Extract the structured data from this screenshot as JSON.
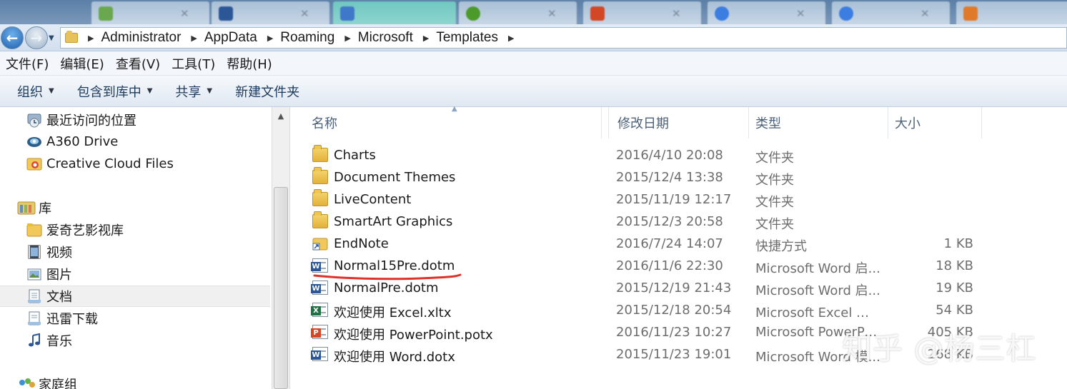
{
  "address": {
    "breadcrumbs": [
      "Administrator",
      "AppData",
      "Roaming",
      "Microsoft",
      "Templates"
    ]
  },
  "menubar": [
    "文件(F)",
    "编辑(E)",
    "查看(V)",
    "工具(T)",
    "帮助(H)"
  ],
  "commandbar": {
    "organize": "组织",
    "include_in_library": "包含到库中",
    "share": "共享",
    "new_folder": "新建文件夹"
  },
  "navpane": {
    "items": [
      {
        "label": "最近访问的位置",
        "icon": "recent-places-icon"
      },
      {
        "label": "A360 Drive",
        "icon": "a360-drive-icon"
      },
      {
        "label": "Creative Cloud Files",
        "icon": "creative-cloud-icon"
      },
      {
        "label": "库",
        "icon": "libraries-icon"
      },
      {
        "label": "爱奇艺影视库",
        "icon": "folder-icon"
      },
      {
        "label": "视频",
        "icon": "video-library-icon"
      },
      {
        "label": "图片",
        "icon": "pictures-library-icon"
      },
      {
        "label": "文档",
        "icon": "documents-library-icon",
        "selected": true
      },
      {
        "label": "迅雷下载",
        "icon": "download-library-icon"
      },
      {
        "label": "音乐",
        "icon": "music-library-icon"
      },
      {
        "label": "家庭组",
        "icon": "homegroup-icon"
      }
    ]
  },
  "columns": {
    "name": "名称",
    "date_modified": "修改日期",
    "type": "类型",
    "size": "大小"
  },
  "files": [
    {
      "name": "Charts",
      "date": "2016/4/10 20:08",
      "type": "文件夹",
      "size": "",
      "icon": "folder-icon"
    },
    {
      "name": "Document Themes",
      "date": "2015/12/4 13:38",
      "type": "文件夹",
      "size": "",
      "icon": "folder-icon"
    },
    {
      "name": "LiveContent",
      "date": "2015/11/19 12:17",
      "type": "文件夹",
      "size": "",
      "icon": "folder-icon"
    },
    {
      "name": "SmartArt Graphics",
      "date": "2015/12/3 20:58",
      "type": "文件夹",
      "size": "",
      "icon": "folder-icon"
    },
    {
      "name": "EndNote",
      "date": "2016/7/24 14:07",
      "type": "快捷方式",
      "size": "1 KB",
      "icon": "shortcut-icon"
    },
    {
      "name": "Normal15Pre.dotm",
      "date": "2016/11/6 22:30",
      "type": "Microsoft Word 启...",
      "size": "18 KB",
      "icon": "word-template-icon"
    },
    {
      "name": "NormalPre.dotm",
      "date": "2015/12/19 21:43",
      "type": "Microsoft Word 启...",
      "size": "19 KB",
      "icon": "word-template-icon"
    },
    {
      "name": "欢迎使用 Excel.xltx",
      "date": "2015/12/18 20:54",
      "type": "Microsoft Excel 模板",
      "size": "54 KB",
      "icon": "excel-template-icon"
    },
    {
      "name": "欢迎使用 PowerPoint.potx",
      "date": "2016/11/23 10:27",
      "type": "Microsoft PowerPo...",
      "size": "405 KB",
      "icon": "powerpoint-template-icon"
    },
    {
      "name": "欢迎使用 Word.dotx",
      "date": "2015/11/23 19:01",
      "type": "Microsoft Word 模...",
      "size": "268 KB",
      "icon": "word-template-icon"
    }
  ],
  "annotation": {
    "highlighted_file": "Normal15Pre.dotm",
    "underline_color": "#e0302a"
  },
  "watermark": "知乎 @杨三杠",
  "colors": {
    "accent": "#1d5fae",
    "word": "#2b5797",
    "excel": "#1e7145",
    "powerpoint": "#d24726",
    "folder": "#e7c25a"
  }
}
